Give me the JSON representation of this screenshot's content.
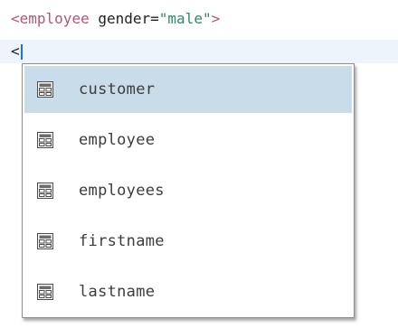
{
  "editor": {
    "line1": {
      "open": "<",
      "tag": "employee",
      "space": " ",
      "attr": "gender",
      "eq": "=",
      "value": "\"male\"",
      "close": ">"
    },
    "line2_text": "<"
  },
  "autocomplete": {
    "items": [
      {
        "label": "customer",
        "icon": "element-icon",
        "selected": true
      },
      {
        "label": "employee",
        "icon": "element-icon",
        "selected": false
      },
      {
        "label": "employees",
        "icon": "element-icon",
        "selected": false
      },
      {
        "label": "firstname",
        "icon": "element-icon",
        "selected": false
      },
      {
        "label": "lastname",
        "icon": "element-icon",
        "selected": false
      }
    ]
  },
  "colors": {
    "tag": "#b5537a",
    "value": "#2a8a6a",
    "selection": "#c8dcea",
    "current_line": "#edf4fb",
    "caret": "#1a73e8"
  }
}
